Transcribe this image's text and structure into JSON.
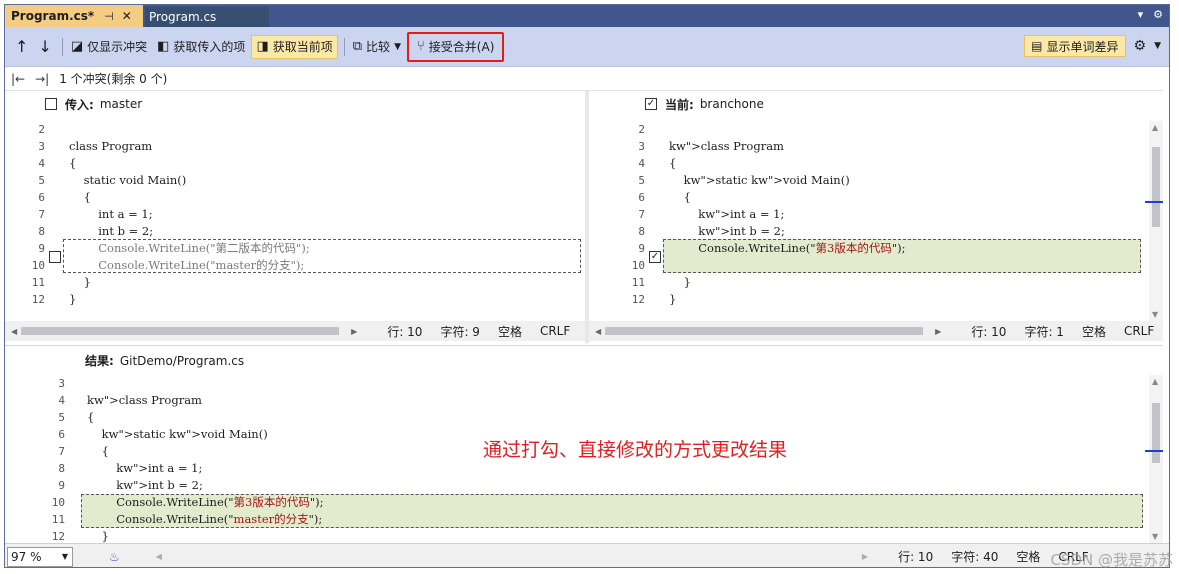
{
  "tabs": {
    "active": {
      "label": "Program.cs*",
      "pin": "⊣",
      "close": "✕"
    },
    "inactive": {
      "label": "Program.cs"
    },
    "right_dropdown": "▾",
    "right_settings": "⚙"
  },
  "toolbar": {
    "up": "↑",
    "down": "↓",
    "only_conflicts": "仅显示冲突",
    "take_incoming": "获取传入的项",
    "take_current": "获取当前项",
    "compare": "比较",
    "accept_merge": "接受合并(A)",
    "show_word_diff": "显示单词差异",
    "settings": "⚙"
  },
  "nav": {
    "first": "|←",
    "last": "→|",
    "conflict_count": "1 个冲突(剩余 0 个)"
  },
  "incoming": {
    "label": "传入:",
    "branch": "master",
    "checked": false,
    "lines": [
      {
        "n": "2",
        "t": ""
      },
      {
        "n": "3",
        "t": "class Program"
      },
      {
        "n": "4",
        "t": "{"
      },
      {
        "n": "5",
        "t": "    static void Main()"
      },
      {
        "n": "6",
        "t": "    {"
      },
      {
        "n": "7",
        "t": "        int a = 1;"
      },
      {
        "n": "8",
        "t": "        int b = 2;"
      },
      {
        "n": "9",
        "t": "        Console.WriteLine(\"第二版本的代码\");"
      },
      {
        "n": "10",
        "t": "        Console.WriteLine(\"master的分支\");"
      },
      {
        "n": "11",
        "t": "    }"
      },
      {
        "n": "12",
        "t": "}"
      }
    ],
    "status": {
      "line": "行: 10",
      "col": "字符: 9",
      "space": "空格",
      "eol": "CRLF"
    }
  },
  "current": {
    "label": "当前:",
    "branch": "branchone",
    "checked": true,
    "lines": [
      {
        "n": "2",
        "t": ""
      },
      {
        "n": "3",
        "t": "class Program"
      },
      {
        "n": "4",
        "t": "{"
      },
      {
        "n": "5",
        "t": "    static void Main()"
      },
      {
        "n": "6",
        "t": "    {"
      },
      {
        "n": "7",
        "t": "        int a = 1;"
      },
      {
        "n": "8",
        "t": "        int b = 2;"
      },
      {
        "n": "9",
        "t": "        Console.WriteLine(\"第3版本的代码\");"
      },
      {
        "n": "10",
        "t": ""
      },
      {
        "n": "11",
        "t": "    }"
      },
      {
        "n": "12",
        "t": "}"
      }
    ],
    "status": {
      "line": "行: 10",
      "col": "字符: 1",
      "space": "空格",
      "eol": "CRLF"
    }
  },
  "result": {
    "label": "结果:",
    "path": "GitDemo/Program.cs",
    "lines": [
      {
        "n": "3",
        "t": ""
      },
      {
        "n": "4",
        "t": "class Program"
      },
      {
        "n": "5",
        "t": "{"
      },
      {
        "n": "6",
        "t": "    static void Main()"
      },
      {
        "n": "7",
        "t": "    {"
      },
      {
        "n": "8",
        "t": "        int a = 1;"
      },
      {
        "n": "9",
        "t": "        int b = 2;"
      },
      {
        "n": "10",
        "t": "        Console.WriteLine(\"第3版本的代码\");"
      },
      {
        "n": "11",
        "t": "        Console.WriteLine(\"master的分支\");"
      },
      {
        "n": "12",
        "t": "    }"
      }
    ],
    "annotation": "通过打勾、直接修改的方式更改结果",
    "status": {
      "zoom": "97 %",
      "line": "行: 10",
      "col": "字符: 40",
      "space": "空格",
      "eol": "CRLF"
    }
  },
  "watermark": "CSDN @我是苏苏",
  "colors": {
    "tab_active": "#f5cc84",
    "tabstrip": "#40568d",
    "toolbar": "#ccd5f0",
    "accent_red": "#e21b1b",
    "keyword": "#1f3fbf",
    "conflict_green": "#e3ebcf"
  }
}
